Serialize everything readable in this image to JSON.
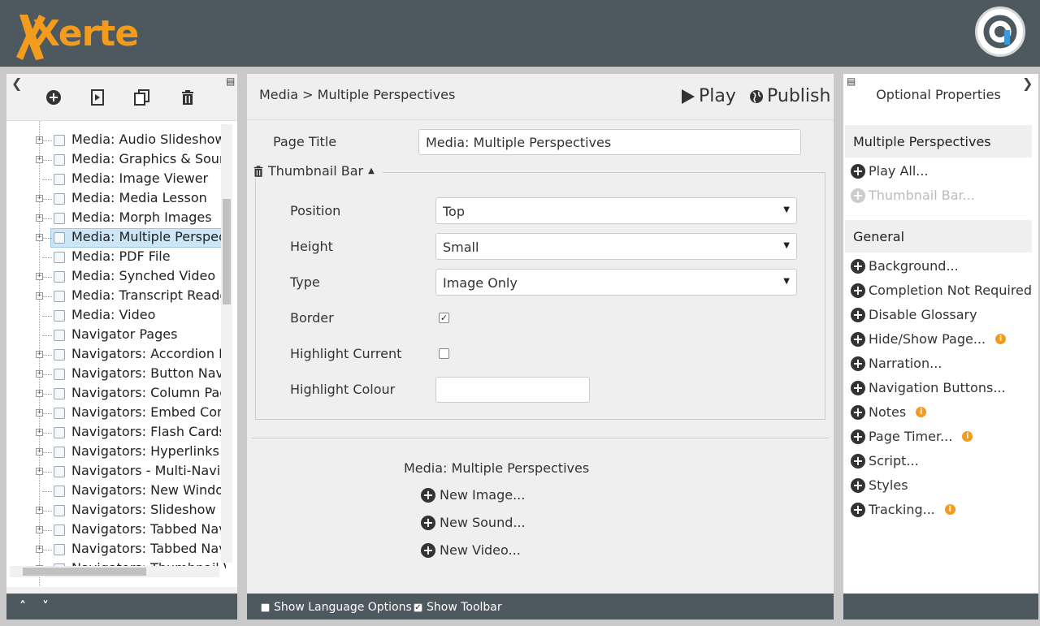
{
  "header": {
    "logo_text": "Xerte",
    "accent": "#f29b1d",
    "bar_color": "#4e585f"
  },
  "left": {
    "toolbar_icons": [
      "add-icon",
      "duplicate-page-icon",
      "copy-icon",
      "delete-icon"
    ],
    "tree": [
      {
        "label": "Media: Audio Slideshow",
        "icon": "speaker-icon",
        "expandable": true
      },
      {
        "label": "Media: Graphics & Sound",
        "icon": "image-sound-icon",
        "expandable": true
      },
      {
        "label": "Media: Image Viewer",
        "icon": "image-viewer-icon",
        "expandable": false
      },
      {
        "label": "Media: Media Lesson",
        "icon": "media-lesson-icon",
        "expandable": true
      },
      {
        "label": "Media: Morph Images",
        "icon": "morph-icon",
        "expandable": true
      },
      {
        "label": "Media: Multiple Perspectives",
        "icon": "person-icon",
        "expandable": true,
        "selected": true
      },
      {
        "label": "Media: PDF File",
        "icon": "pdf-icon",
        "expandable": false
      },
      {
        "label": "Media: Synched Video",
        "icon": "synched-video-icon",
        "expandable": true
      },
      {
        "label": "Media: Transcript Reader",
        "icon": "transcript-icon",
        "expandable": true
      },
      {
        "label": "Media: Video",
        "icon": "video-icon",
        "expandable": false
      },
      {
        "label": "Navigator Pages",
        "icon": "navigator-pages-icon",
        "expandable": false
      },
      {
        "label": "Navigators: Accordion Navigator",
        "icon": "pages-icon",
        "expandable": true
      },
      {
        "label": "Navigators: Button Navigator",
        "icon": "pages-icon",
        "expandable": true
      },
      {
        "label": "Navigators: Column Pages",
        "icon": "pages-icon",
        "expandable": true
      },
      {
        "label": "Navigators: Embed Content",
        "icon": "embed-icon",
        "expandable": true
      },
      {
        "label": "Navigators: Flash Cards",
        "icon": "flash-cards-icon",
        "expandable": true
      },
      {
        "label": "Navigators: Hyperlinks",
        "icon": "globe-icon",
        "expandable": true
      },
      {
        "label": "Navigators - Multi-Navigator",
        "icon": "pages-icon",
        "expandable": true
      },
      {
        "label": "Navigators: New Window",
        "icon": "window-icon",
        "expandable": false
      },
      {
        "label": "Navigators: Slideshow Navigator",
        "icon": "pages-icon",
        "expandable": true
      },
      {
        "label": "Navigators: Tabbed Navigator",
        "icon": "pages-icon",
        "expandable": true
      },
      {
        "label": "Navigators: Tabbed Navigator",
        "icon": "tabbed-icon",
        "expandable": true
      },
      {
        "label": "Navigators: Thumbnail Viewer",
        "icon": "thumbnail-icon",
        "expandable": true
      }
    ]
  },
  "center": {
    "breadcrumb": "Media > Multiple Perspectives",
    "play_label": "Play",
    "publish_label": "Publish",
    "page_title_label": "Page Title",
    "page_title_value": "Media: Multiple Perspectives",
    "thumbnail_bar_label": "Thumbnail Bar",
    "position_label": "Position",
    "position_value": "Top",
    "height_label": "Height",
    "height_value": "Small",
    "type_label": "Type",
    "type_value": "Image Only",
    "border_label": "Border",
    "border_checked": true,
    "highlight_current_label": "Highlight Current",
    "highlight_current_checked": false,
    "highlight_colour_label": "Highlight Colour",
    "highlight_colour_value": "",
    "child_title": "Media: Multiple Perspectives",
    "new_image_label": "New Image...",
    "new_sound_label": "New Sound...",
    "new_video_label": "New Video...",
    "show_language_options_label": "Show Language Options",
    "show_language_options_checked": false,
    "show_toolbar_label": "Show Toolbar",
    "show_toolbar_checked": true
  },
  "right": {
    "title": "Optional Properties",
    "section1": "Multiple Perspectives",
    "play_all": "Play All...",
    "thumbnail_bar": "Thumbnail Bar...",
    "section2": "General",
    "items": [
      {
        "label": "Background...",
        "info": false
      },
      {
        "label": "Completion Not Required",
        "info": false
      },
      {
        "label": "Disable Glossary",
        "info": false
      },
      {
        "label": "Hide/Show Page...",
        "info": true
      },
      {
        "label": "Narration...",
        "info": false
      },
      {
        "label": "Navigation Buttons...",
        "info": false
      },
      {
        "label": "Notes",
        "info": true
      },
      {
        "label": "Page Timer...",
        "info": true
      },
      {
        "label": "Script...",
        "info": false
      },
      {
        "label": "Styles",
        "info": false
      },
      {
        "label": "Tracking...",
        "info": true
      }
    ]
  }
}
